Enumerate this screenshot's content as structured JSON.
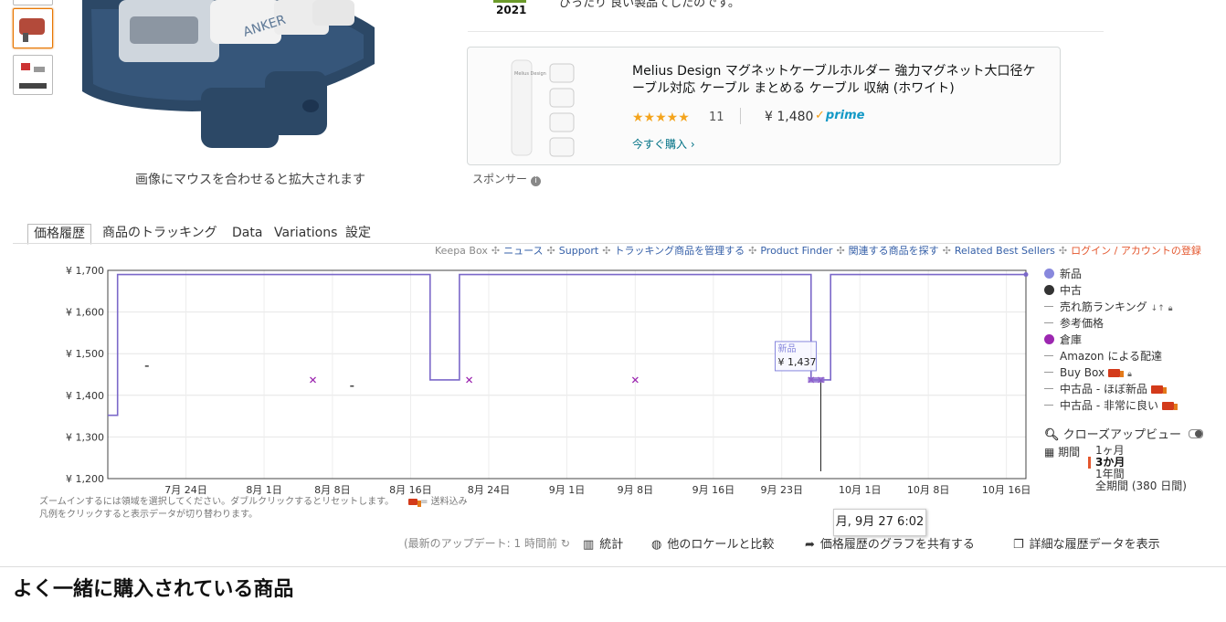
{
  "product_image": {
    "hint": "画像にマウスを合わせると拡大されます",
    "brand_on_image": "ANKER"
  },
  "award": {
    "year": "2021"
  },
  "top_text": "ぴったり 良い製品てしたのです。",
  "sponsored": {
    "title": "Melius Design マグネットケーブルホルダー 強力マグネット大口径ケーブル対応 ケーブル まとめる ケーブル 収納 (ホワイト)",
    "stars": "★★★★★",
    "rating_count": "11",
    "price": "¥ 1,480",
    "prime": "prime",
    "buy_now": "今すぐ購入 ›",
    "thumb_brand": "Melius Design",
    "label": "スポンサー"
  },
  "tabs": [
    {
      "label": "価格履歴"
    },
    {
      "label": "商品のトラッキング"
    },
    {
      "label": "Data"
    },
    {
      "label": "Variations"
    },
    {
      "label": "設定"
    }
  ],
  "links": {
    "keepa_box": "Keepa Box",
    "news": "ニュース",
    "support": "Support",
    "manage": "トラッキング商品を管理する",
    "finder": "Product Finder",
    "related": "関連する商品を探す",
    "best": "Related Best Sellers",
    "login": "ログイン / アカウントの登録"
  },
  "legend": {
    "new": "新品",
    "used": "中古",
    "sales_rank": "売れ筋ランキング",
    "list_price": "参考価格",
    "warehouse": "倉庫",
    "amazon_fba": "Amazon による配達",
    "buy_box": "Buy Box",
    "used_like_new": "中古品 - ほぼ新品",
    "used_very_good": "中古品 - 非常に良い",
    "colors": {
      "new": "#8888dd",
      "used": "#333333",
      "warehouse": "#9c27b0"
    }
  },
  "closeup": {
    "label": "クローズアップビュー"
  },
  "period": {
    "label": "期間",
    "options": [
      "1ヶ月",
      "3か月",
      "1年間",
      "全期間 (380 日間)"
    ],
    "selected": "3か月"
  },
  "zoom_hint": {
    "line1": "ズームインするには領域を選択してください。ダブルクリックするとリセットします。",
    "shipping_note": "= 送料込み",
    "line2": "凡例をクリックすると表示データが切り替わります。"
  },
  "tooltip": {
    "series": "新品",
    "value": "¥ 1,437",
    "time": "月, 9月 27 6:02"
  },
  "bottom_bar": {
    "last_update": "(最新のアップデート: 1 時間前",
    "stats": "統計",
    "compare": "他のロケールと比較",
    "share": "価格履歴のグラフを共有する",
    "detail": "詳細な履歴データを表示"
  },
  "section_title": "よく一緒に購入されている商品",
  "chart_data": {
    "type": "line",
    "title": "",
    "xlabel": "",
    "ylabel": "",
    "ylim": [
      1200,
      1700
    ],
    "yticks": [
      "¥ 1,700",
      "¥ 1,600",
      "¥ 1,500",
      "¥ 1,400",
      "¥ 1,300",
      "¥ 1,200"
    ],
    "ytick_values": [
      1700,
      1600,
      1500,
      1400,
      1300,
      1200
    ],
    "xdomain": [
      "2021-07-16",
      "2021-10-18"
    ],
    "xticks": [
      {
        "label": "7月 24日",
        "date": "2021-07-24"
      },
      {
        "label": "8月 1日",
        "date": "2021-08-01"
      },
      {
        "label": "8月 8日",
        "date": "2021-08-08"
      },
      {
        "label": "8月 16日",
        "date": "2021-08-16"
      },
      {
        "label": "8月 24日",
        "date": "2021-08-24"
      },
      {
        "label": "9月 1日",
        "date": "2021-09-01"
      },
      {
        "label": "9月 8日",
        "date": "2021-09-08"
      },
      {
        "label": "9月 16日",
        "date": "2021-09-16"
      },
      {
        "label": "9月 23日",
        "date": "2021-09-23"
      },
      {
        "label": "10月 1日",
        "date": "2021-10-01"
      },
      {
        "label": "10月 8日",
        "date": "2021-10-08"
      },
      {
        "label": "10月 16日",
        "date": "2021-10-16"
      }
    ],
    "grid": true,
    "series": [
      {
        "name": "新品",
        "color": "#7b68c9",
        "step": true,
        "points": [
          [
            "2021-07-16",
            1352
          ],
          [
            "2021-07-17",
            1352
          ],
          [
            "2021-07-17",
            1690
          ],
          [
            "2021-08-18",
            1690
          ],
          [
            "2021-08-18",
            1437
          ],
          [
            "2021-08-21",
            1437
          ],
          [
            "2021-08-21",
            1690
          ],
          [
            "2021-09-23",
            1690
          ],
          [
            "2021-09-26",
            1690
          ],
          [
            "2021-09-26",
            1437
          ],
          [
            "2021-09-28",
            1437
          ],
          [
            "2021-09-28",
            1690
          ],
          [
            "2021-10-18",
            1690
          ]
        ]
      },
      {
        "name": "倉庫",
        "color": "#9c27b0",
        "points": [
          [
            "2021-08-06",
            1437
          ],
          [
            "2021-08-22",
            1437
          ],
          [
            "2021-09-08",
            1437
          ],
          [
            "2021-09-26",
            1437
          ],
          [
            "2021-09-27",
            1437
          ]
        ]
      },
      {
        "name": "中古",
        "color": "#333333",
        "points": [
          [
            "2021-07-20",
            1470
          ],
          [
            "2021-08-10",
            1422
          ]
        ]
      }
    ],
    "hover": {
      "date": "2021-09-27",
      "value": 1437
    }
  }
}
